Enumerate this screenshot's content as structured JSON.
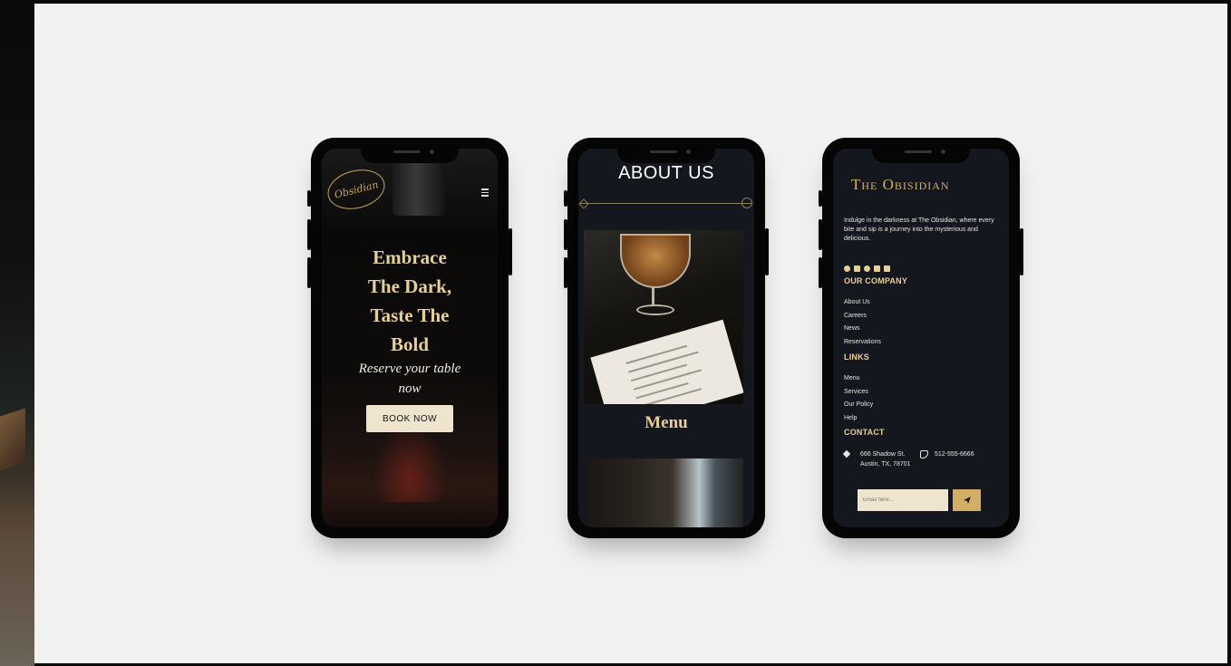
{
  "phone1": {
    "logo_text": "Obsidian",
    "hero_title_lines": [
      "Embrace",
      "The Dark,",
      "Taste The",
      "Bold"
    ],
    "hero_subtitle_lines": [
      "Reserve your table",
      "now"
    ],
    "book_button": "BOOK NOW",
    "menu_icon": "hamburger-icon"
  },
  "phone2": {
    "heading": "ABOUT US",
    "menu_heading": "Menu"
  },
  "phone3": {
    "brand": "The Obisidian",
    "tagline": "Indulge in the darkness at The Obsidian, where every bite and sip is a journey into the mysterious and delicious.",
    "social_icons": [
      "facebook-icon",
      "instagram-icon",
      "youtube-icon",
      "twitter-icon",
      "linkedin-icon"
    ],
    "company": {
      "heading": "OUR COMPANY",
      "items": [
        "About Us",
        "Careers",
        "News",
        "Reservations"
      ]
    },
    "links": {
      "heading": "LINKS",
      "items": [
        "Menu",
        "Services",
        "Our Policy",
        "Help"
      ]
    },
    "contact": {
      "heading": "CONTACT",
      "address_line1": "666 Shadow St.",
      "address_line2": "Austin, TX, 78701",
      "phone": "512-555-6666"
    },
    "newsletter": {
      "placeholder": "Email here..."
    }
  },
  "colors": {
    "gold": "#e7cf98",
    "dark_screen": "#15171f",
    "canvas": "#f1f1ef",
    "button_cream": "#efe5cf"
  }
}
